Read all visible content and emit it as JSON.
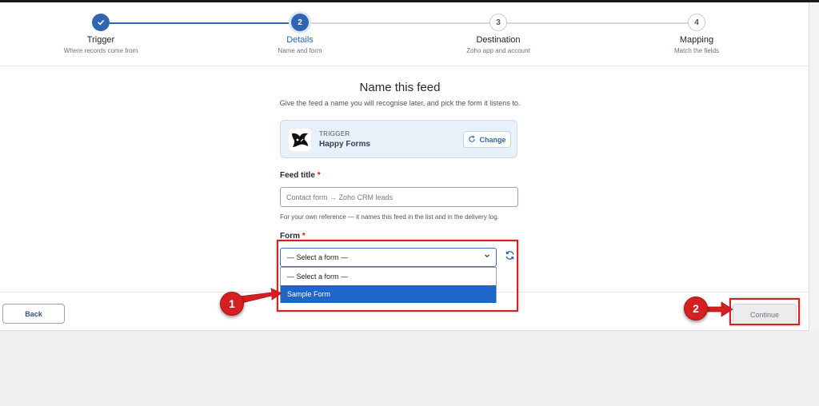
{
  "stepper": {
    "steps": [
      {
        "title": "Trigger",
        "subtitle": "Where records come from",
        "number": "",
        "status": "done"
      },
      {
        "title": "Details",
        "subtitle": "Name and form",
        "number": "2",
        "status": "active"
      },
      {
        "title": "Destination",
        "subtitle": "Zoho app and account",
        "number": "3",
        "status": "todo"
      },
      {
        "title": "Mapping",
        "subtitle": "Match the fields",
        "number": "4",
        "status": "todo"
      }
    ]
  },
  "main": {
    "heading": "Name this feed",
    "subheading": "Give the feed a name you will recognise later, and pick the form it listens to.",
    "trigger_card": {
      "kicker": "TRIGGER",
      "name": "Happy Forms",
      "change_label": "Change"
    },
    "feed_title": {
      "label": "Feed title",
      "required_mark": "*",
      "value": "",
      "placeholder": "Contact form → Zoho CRM leads",
      "help": "For your own reference — it names this feed in the list and in the delivery log."
    },
    "form": {
      "label": "Form",
      "required_mark": "*",
      "selected": "— Select a form —",
      "options": [
        "— Select a form —",
        "Sample Form"
      ],
      "highlighted_option": "Sample Form"
    }
  },
  "footer": {
    "back_label": "Back",
    "continue_label": "Continue"
  },
  "annotations": {
    "badge_1": "1",
    "badge_2": "2",
    "color": "#d42020"
  },
  "colors": {
    "accent": "#2f66b1",
    "selected_option": "#1e66c9"
  }
}
